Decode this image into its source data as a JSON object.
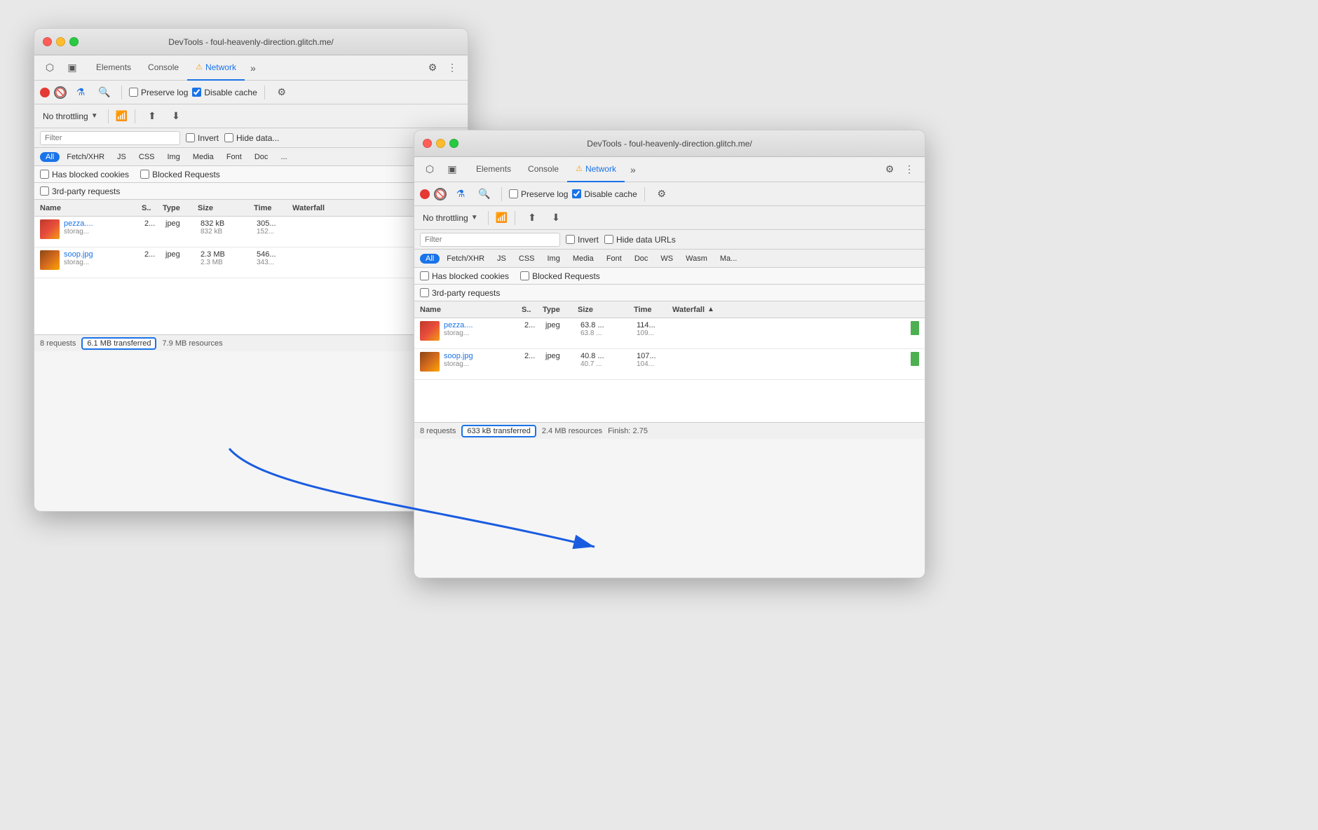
{
  "window1": {
    "title": "DevTools - foul-heavenly-direction.glitch.me/",
    "tabs": {
      "elements": "Elements",
      "console": "Console",
      "network": "Network",
      "more": "»"
    },
    "toolbar": {
      "preserve_log": "Preserve log",
      "disable_cache": "Disable cache",
      "no_throttling": "No throttling"
    },
    "filter": {
      "placeholder": "Filter",
      "invert": "Invert",
      "hide_data": "Hide data..."
    },
    "filter_tags": [
      "All",
      "Fetch/XHR",
      "JS",
      "CSS",
      "Img",
      "Media",
      "Font",
      "Doc"
    ],
    "checkboxes": {
      "blocked_cookies": "Has blocked cookies",
      "blocked_requests": "Blocked Requests",
      "third_party": "3rd-party requests"
    },
    "table_headers": [
      "Name",
      "S..",
      "Type",
      "Size",
      "Time",
      "Waterfall"
    ],
    "rows": [
      {
        "thumb": "pezza",
        "name": "pezza....",
        "name2": "storag...",
        "status": "2...",
        "type": "jpeg",
        "size": "832 kB",
        "size2": "832 kB",
        "time": "305...",
        "time2": "152..."
      },
      {
        "thumb": "soop",
        "name": "soop.jpg",
        "name2": "storag...",
        "status": "2...",
        "type": "jpeg",
        "size": "2.3 MB",
        "size2": "2.3 MB",
        "time": "546...",
        "time2": "343..."
      }
    ],
    "statusbar": {
      "requests": "8 requests",
      "transferred": "6.1 MB transferred",
      "resources": "7.9 MB resources"
    }
  },
  "window2": {
    "title": "DevTools - foul-heavenly-direction.glitch.me/",
    "tabs": {
      "elements": "Elements",
      "console": "Console",
      "network": "Network",
      "more": "»"
    },
    "toolbar": {
      "preserve_log": "Preserve log",
      "disable_cache": "Disable cache",
      "no_throttling": "No throttling"
    },
    "filter": {
      "placeholder": "Filter",
      "invert": "Invert",
      "hide_data": "Hide data URLs"
    },
    "filter_tags": [
      "All",
      "Fetch/XHR",
      "JS",
      "CSS",
      "Img",
      "Media",
      "Font",
      "Doc",
      "WS",
      "Wasm",
      "Ma..."
    ],
    "checkboxes": {
      "blocked_cookies": "Has blocked cookies",
      "blocked_requests": "Blocked Requests",
      "third_party": "3rd-party requests"
    },
    "table_headers": [
      "Name",
      "S..",
      "Type",
      "Size",
      "Time",
      "Waterfall",
      "▲"
    ],
    "rows": [
      {
        "thumb": "pezza",
        "name": "pezza....",
        "name2": "storag...",
        "status": "2...",
        "type": "jpeg",
        "size": "63.8 ...",
        "size2": "63.8 ...",
        "time": "114...",
        "time2": "109..."
      },
      {
        "thumb": "soop",
        "name": "soop.jpg",
        "name2": "storag...",
        "status": "2...",
        "type": "jpeg",
        "size": "40.8 ...",
        "size2": "40.7 ...",
        "time": "107...",
        "time2": "104..."
      }
    ],
    "statusbar": {
      "requests": "8 requests",
      "transferred": "633 kB transferred",
      "resources": "2.4 MB resources",
      "finish": "Finish: 2.75"
    }
  }
}
